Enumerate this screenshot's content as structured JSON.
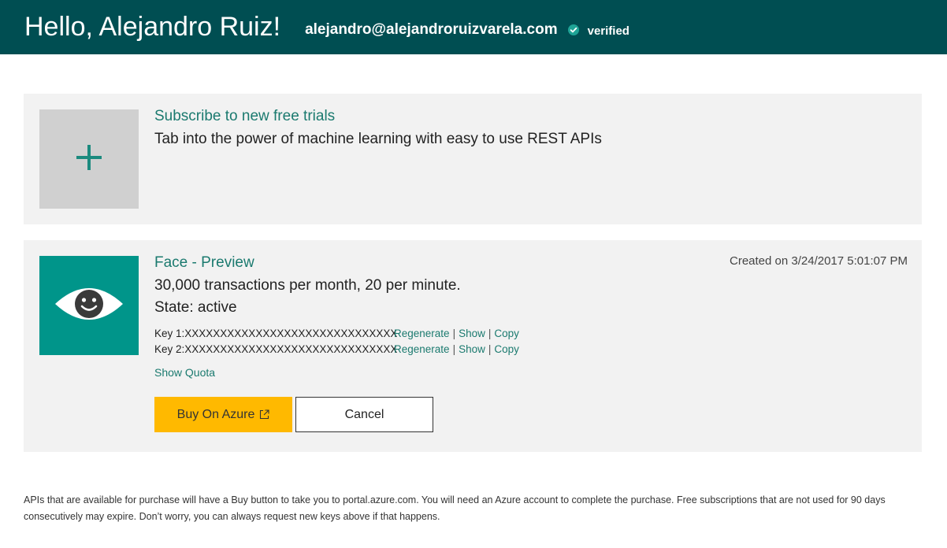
{
  "header": {
    "greeting": "Hello, Alejandro Ruiz!",
    "email": "alejandro@alejandroruizvarela.com",
    "verified_label": "verified",
    "background_color": "#004e52"
  },
  "new_trials": {
    "icon": "plus-icon",
    "title": "Subscribe to new free trials",
    "description": "Tab into the power of machine learning with easy to use REST APIs"
  },
  "subscription": {
    "icon": "eye-icon",
    "name": "Face - Preview",
    "created": "Created on 3/24/2017 5:01:07 PM",
    "plan": "30,000 transactions per month, 20 per minute.",
    "state": "State: active",
    "keys": [
      {
        "label": "Key 1:XXXXXXXXXXXXXXXXXXXXXXXXXXXXXX",
        "regenerate": "Regenerate",
        "show": "Show",
        "copy": "Copy"
      },
      {
        "label": "Key 2:XXXXXXXXXXXXXXXXXXXXXXXXXXXXXX",
        "regenerate": "Regenerate",
        "show": "Show",
        "copy": "Copy"
      }
    ],
    "separator": "|",
    "show_quota": "Show Quota",
    "buy_label": "Buy On Azure",
    "cancel_label": "Cancel"
  },
  "footer": {
    "note": "APIs that are available for purchase will have a Buy button to take you to portal.azure.com. You will need an Azure account to complete the purchase. Free subscriptions that are not used for 90 days consecutively may expire. Don’t worry, you can always request new keys above if that happens."
  },
  "colors": {
    "accent": "#1b7a6f",
    "tile_green": "#00958a",
    "buy_button": "#ffb900",
    "card_background": "#f2f2f2"
  }
}
